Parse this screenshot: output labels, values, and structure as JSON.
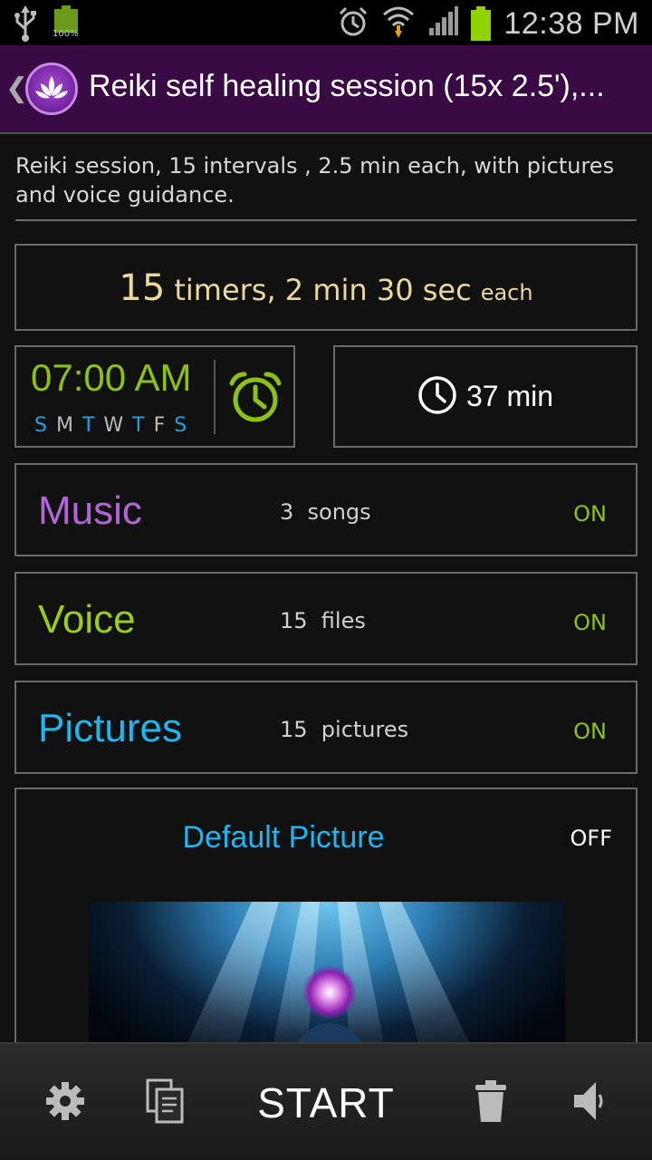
{
  "status_bar": {
    "battery_small_label": "100%",
    "time": "12:38 PM",
    "icons": [
      "usb-icon",
      "battery-charging-icon",
      "alarm-clock-icon",
      "wifi-icon",
      "signal-icon",
      "battery-icon"
    ]
  },
  "action_bar": {
    "back_glyph": "❮",
    "title": "Reiki self healing session (15x 2.5'),...",
    "accent_color": "#3a0a44"
  },
  "description": "Reiki session, 15 intervals , 2.5  min each, with pictures and voice guidance.",
  "timers": {
    "count": "15",
    "duration_text": "timers, 2 min 30 sec",
    "each": "each"
  },
  "alarm": {
    "time": "07:00 AM",
    "days": [
      {
        "letter": "S",
        "active": true
      },
      {
        "letter": "M",
        "active": false
      },
      {
        "letter": "T",
        "active": true
      },
      {
        "letter": "W",
        "active": false
      },
      {
        "letter": "T",
        "active": true
      },
      {
        "letter": "F",
        "active": false
      },
      {
        "letter": "S",
        "active": true
      }
    ]
  },
  "duration": {
    "total": "37 min"
  },
  "music": {
    "title": "Music",
    "info": "3  songs",
    "state": "ON",
    "color": "#b266d6"
  },
  "voice": {
    "title": "Voice",
    "info": "15  files",
    "state": "ON",
    "color": "#9acd1a"
  },
  "pictures": {
    "title": "Pictures",
    "info": "15  pictures",
    "state": "ON",
    "color": "#1fb5f0"
  },
  "default_picture": {
    "title": "Default Picture",
    "state": "OFF"
  },
  "bottom_bar": {
    "start_label": "START",
    "icons": [
      "settings-icon",
      "copy-icon",
      "delete-icon",
      "volume-icon"
    ]
  },
  "colors": {
    "on_green": "#8cc11a",
    "day_active": "#1fa3e0",
    "day_inactive": "#bbbbbb",
    "timer_text": "#e9d9a0"
  }
}
